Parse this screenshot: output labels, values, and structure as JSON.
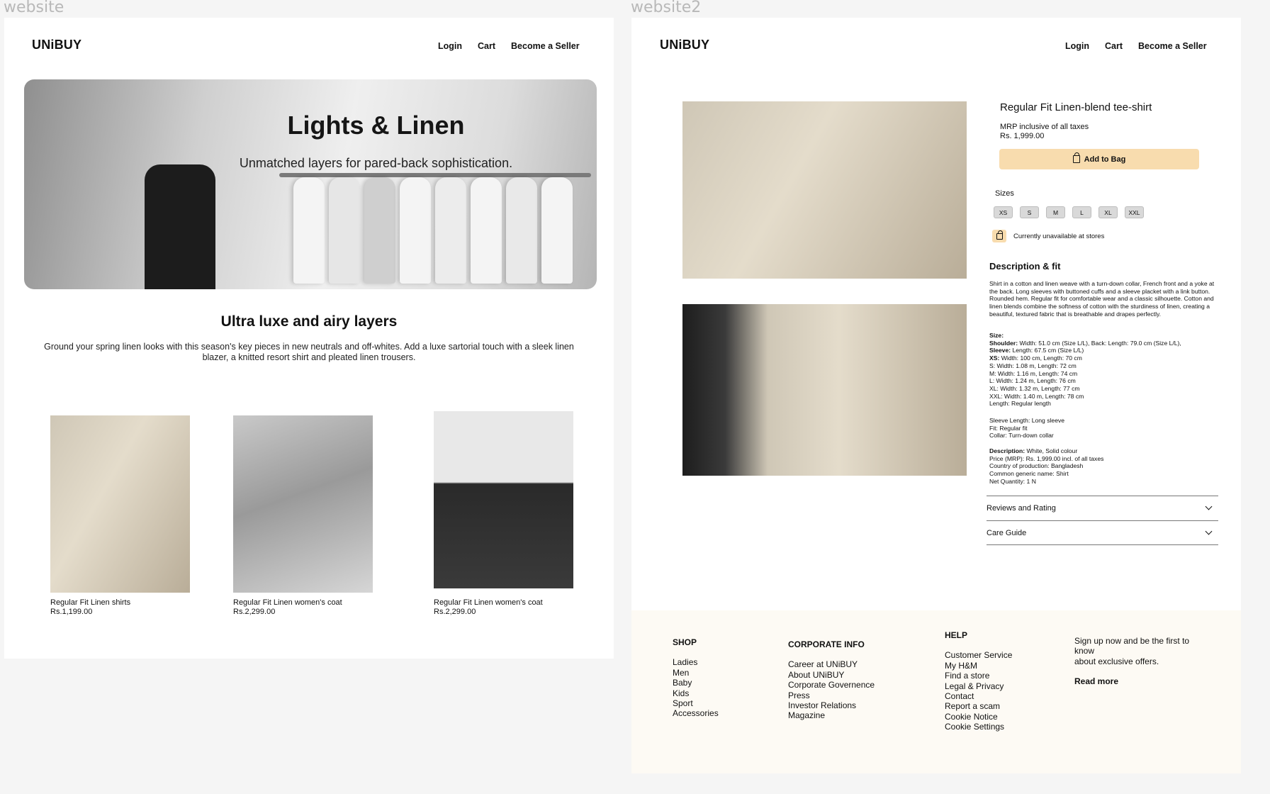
{
  "frames": {
    "left_label": "website",
    "right_label": "website2"
  },
  "brand": "UNiBUY",
  "nav": [
    "Login",
    "Cart",
    "Become a Seller"
  ],
  "hero": {
    "title": "Lights & Linen",
    "subtitle": "Unmatched layers for pared-back sophistication."
  },
  "intro": {
    "title": "Ultra luxe and airy layers",
    "body": "Ground your spring linen looks with this season's key pieces in new neutrals and off-whites. Add a luxe sartorial touch with a sleek linen blazer, a knitted resort shirt and pleated linen trousers."
  },
  "products": [
    {
      "name": "Regular Fit Linen shirts",
      "price": "Rs.1,199.00"
    },
    {
      "name": "Regular Fit Linen women's coat",
      "price": "Rs.2,299.00"
    },
    {
      "name": "Regular Fit Linen women's coat",
      "price": "Rs.2,299.00"
    }
  ],
  "product_detail": {
    "title": "Regular Fit Linen-blend tee-shirt",
    "mrp_note": "MRP inclusive of all taxes",
    "price": "Rs. 1,999.00",
    "add_to_bag": "Add to Bag",
    "sizes_label": "Sizes",
    "sizes": [
      "XS",
      "S",
      "M",
      "L",
      "XL",
      "XXL"
    ],
    "store_status": "Currently unavailable at stores",
    "description_title": "Description & fit",
    "description": "Shirt in a cotton and linen weave with a turn-down collar, French front and a yoke at the back. Long sleeves with buttoned cuffs and a sleeve placket with a link button. Rounded hem. Regular fit for comfortable wear and a classic silhouette. Cotton and linen blends combine the softness of cotton with the sturdiness of linen, creating a beautiful, textured fabric that is breathable and drapes perfectly.",
    "size_heading": "Size:",
    "shoulder_label": "Shoulder:",
    "shoulder_value": "Width: 51.0 cm (Size L/L), Back: Length: 79.0 cm (Size L/L),",
    "sleeve_label": "Sleeve:",
    "sleeve_value": "Length: 67.5 cm (Size L/L)",
    "xs_label": "XS:",
    "xs_value": "Width: 100 cm, Length: 70 cm",
    "size_lines": [
      "S: Width: 1.08 m, Length: 72 cm",
      "M: Width: 1.16 m, Length: 74 cm",
      "L: Width: 1.24 m, Length: 76 cm",
      "XL: Width: 1.32 m, Length: 77 cm",
      "XXL: Width: 1.40 m, Length: 78 cm",
      "Length: Regular length"
    ],
    "fit_lines": [
      "Sleeve Length: Long sleeve",
      "Fit: Regular fit",
      "Collar: Turn-down collar"
    ],
    "desc_label": "Description:",
    "desc_value": "White, Solid colour",
    "meta_lines": [
      "Price (MRP): Rs. 1,999.00 incl. of all taxes",
      "Country of production: Bangladesh",
      "Common generic name: Shirt",
      "Net Quantity: 1 N"
    ],
    "accordions": [
      "Reviews and Rating",
      "Care Guide"
    ]
  },
  "footer": {
    "shop": {
      "title": "SHOP",
      "items": [
        "Ladies",
        "Men",
        "Baby",
        "Kids",
        "Sport",
        "Accessories"
      ]
    },
    "corporate": {
      "title": "CORPORATE INFO",
      "items": [
        "Career at UNiBUY",
        "About UNiBUY",
        "Corporate Governence",
        "Press",
        "Investor Relations",
        "Magazine"
      ]
    },
    "help": {
      "title": "HELP",
      "items": [
        "Customer Service",
        "My H&M",
        "Find a store",
        "Legal & Privacy",
        "Contact",
        "Report a scam",
        "Cookie Notice",
        "Cookie Settings"
      ]
    },
    "signup": {
      "text_1": "Sign up now and be the first to know",
      "text_2": "about exclusive offers.",
      "link": "Read more"
    }
  },
  "colors": {
    "page_bg": "#f5f5f5",
    "accent": "#f8dcae",
    "footer_bg": "#fdfaf4"
  }
}
